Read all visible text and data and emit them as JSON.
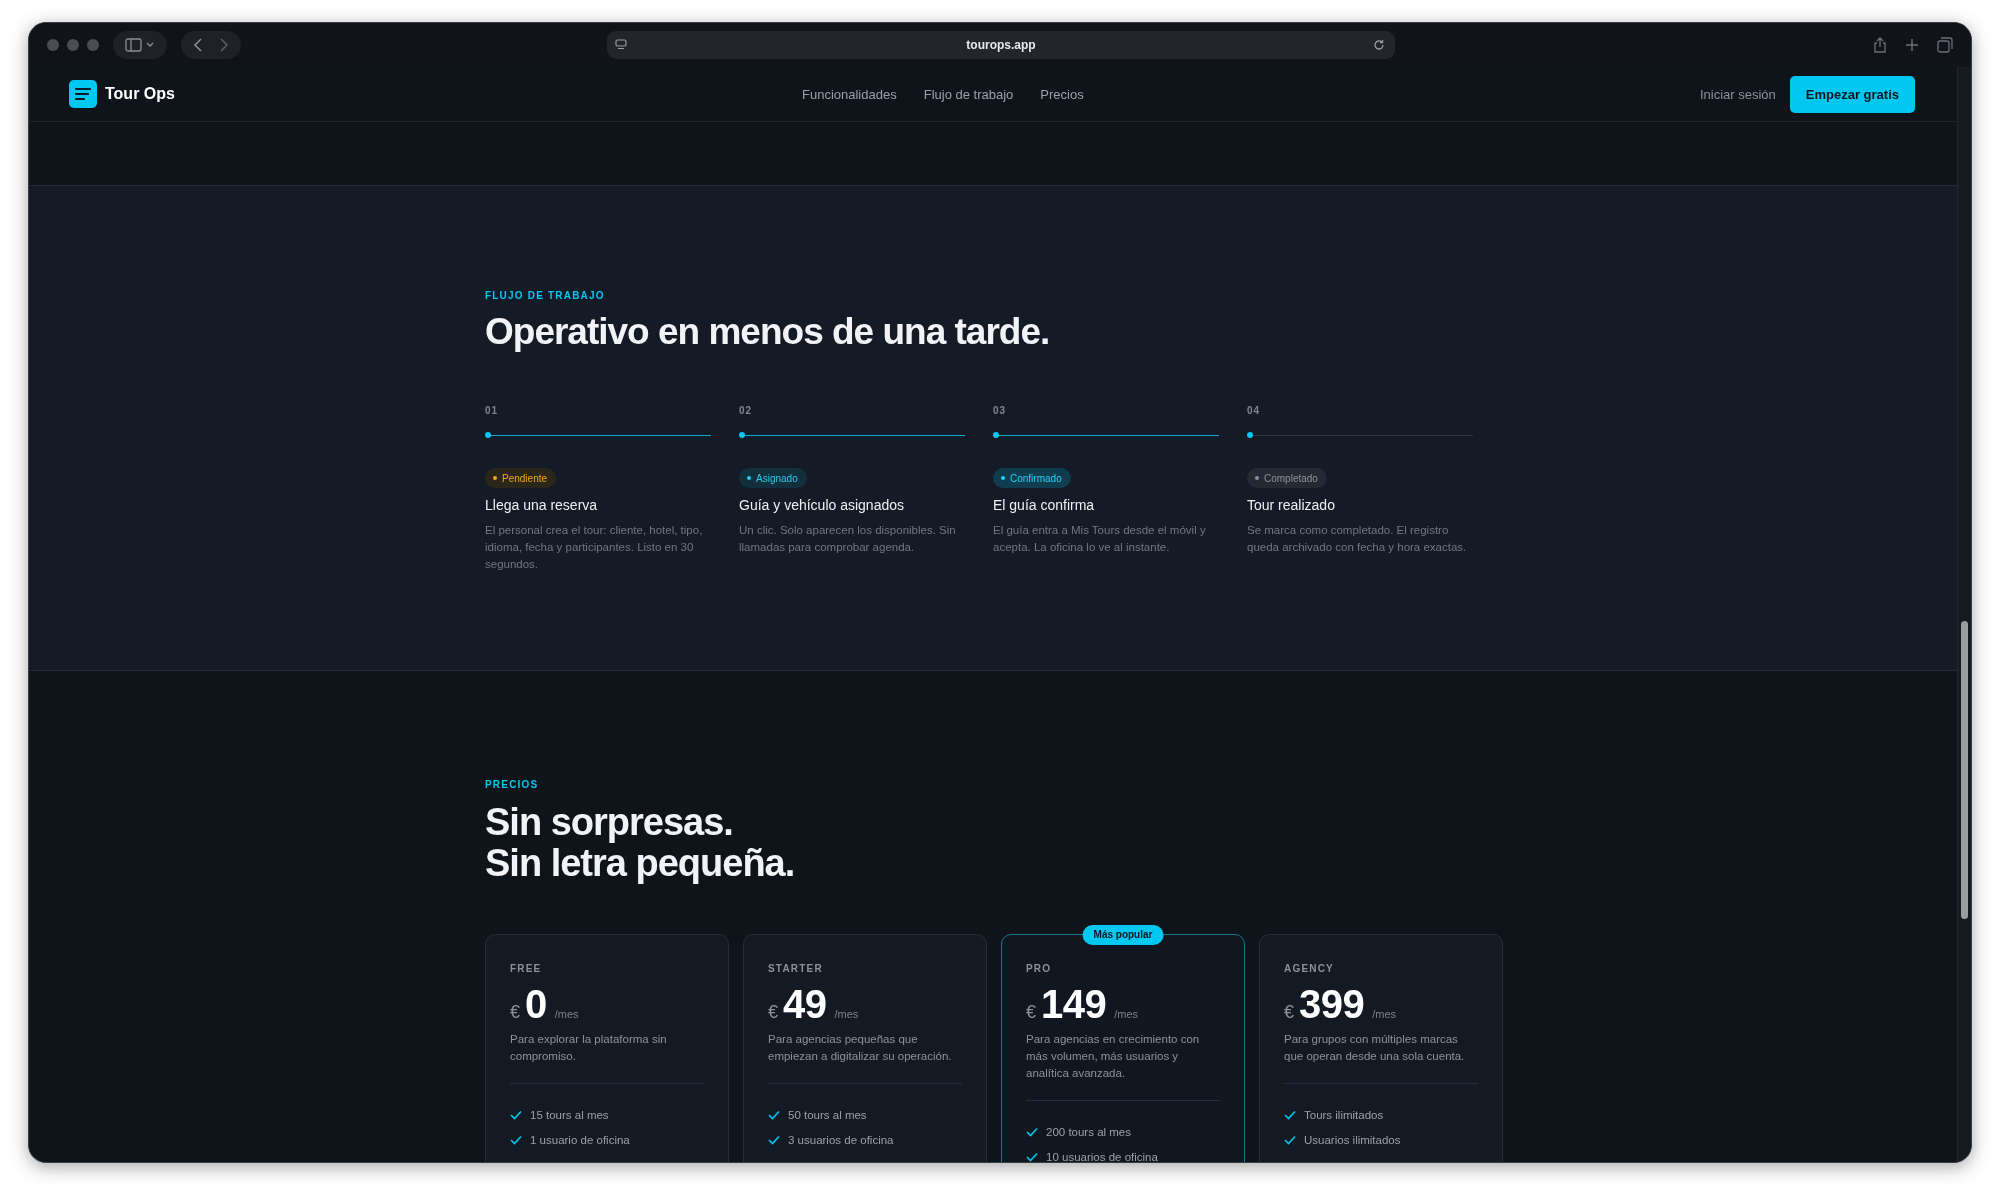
{
  "browser": {
    "url": "tourops.app"
  },
  "nav": {
    "brand": "Tour Ops",
    "links": [
      "Funcionalidades",
      "Flujo de trabajo",
      "Precios"
    ],
    "login": "Iniciar sesión",
    "cta": "Empezar gratis"
  },
  "workflow": {
    "eyebrow": "FLUJO DE TRABAJO",
    "title": "Operativo en menos de una tarde.",
    "steps": [
      {
        "number": "01",
        "active": true,
        "badge": {
          "label": "Pendiente",
          "kind": "pending"
        },
        "title": "Llega una reserva",
        "description": "El personal crea el tour: cliente, hotel, tipo, idioma, fecha y participantes. Listo en 30 segundos."
      },
      {
        "number": "02",
        "active": true,
        "badge": {
          "label": "Asignado",
          "kind": "assigned"
        },
        "title": "Guía y vehículo asignados",
        "description": "Un clic. Solo aparecen los disponibles. Sin llamadas para comprobar agenda."
      },
      {
        "number": "03",
        "active": true,
        "badge": {
          "label": "Confirmado",
          "kind": "confirmed"
        },
        "title": "El guía confirma",
        "description": "El guía entra a Mis Tours desde el móvil y acepta. La oficina lo ve al instante."
      },
      {
        "number": "04",
        "active": false,
        "badge": {
          "label": "Completado",
          "kind": "done"
        },
        "title": "Tour realizado",
        "description": "Se marca como completado. El registro queda archivado con fecha y hora exactas."
      }
    ]
  },
  "pricing": {
    "eyebrow": "PRECIOS",
    "title_lines": [
      "Sin sorpresas.",
      "Sin letra pequeña."
    ],
    "cards": [
      {
        "plan": "FREE",
        "currency": "€",
        "price": "0",
        "period": "/mes",
        "featured": false,
        "description": "Para explorar la plataforma sin compromiso.",
        "features": [
          "15 tours al mes",
          "1 usuario de oficina"
        ]
      },
      {
        "plan": "STARTER",
        "currency": "€",
        "price": "49",
        "period": "/mes",
        "featured": false,
        "description": "Para agencias pequeñas que empiezan a digitalizar su operación.",
        "features": [
          "50 tours al mes",
          "3 usuarios de oficina"
        ]
      },
      {
        "plan": "PRO",
        "currency": "€",
        "price": "149",
        "period": "/mes",
        "featured": true,
        "badge": "Más popular",
        "description": "Para agencias en crecimiento con más volumen, más usuarios y analítica avanzada.",
        "features": [
          "200 tours al mes",
          "10 usuarios de oficina"
        ]
      },
      {
        "plan": "AGENCY",
        "currency": "€",
        "price": "399",
        "period": "/mes",
        "featured": false,
        "description": "Para grupos con múltiples marcas que operan desde una sola cuenta.",
        "features": [
          "Tours ilimitados",
          "Usuarios ilimitados"
        ]
      }
    ]
  }
}
